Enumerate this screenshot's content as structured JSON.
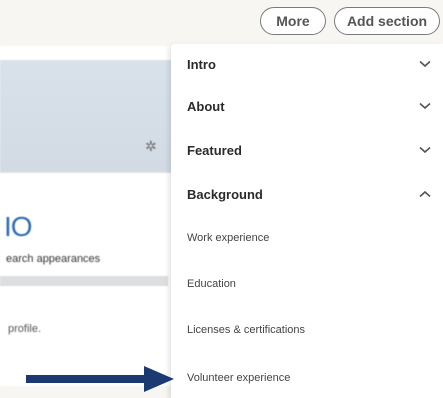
{
  "toolbar": {
    "more_label": "More",
    "add_section_label": "Add section"
  },
  "profile_bg": {
    "count_text": "IO",
    "search_label": "earch appearances",
    "profile_text": "profile."
  },
  "menu": {
    "items": [
      {
        "label": "Intro",
        "kind": "section",
        "chevron": "chevron-down-icon"
      },
      {
        "label": "About",
        "kind": "section",
        "chevron": "chevron-down-icon"
      },
      {
        "label": "Featured",
        "kind": "section",
        "chevron": "chevron-down-icon"
      },
      {
        "label": "Background",
        "kind": "section",
        "chevron": "chevron-up-icon"
      },
      {
        "label": "Work experience",
        "kind": "sub"
      },
      {
        "label": "Education",
        "kind": "sub"
      },
      {
        "label": "Licenses & certifications",
        "kind": "sub"
      },
      {
        "label": "Volunteer experience",
        "kind": "sub"
      }
    ]
  },
  "colors": {
    "accent": "#1c3a72",
    "count": "#2f6db3"
  }
}
